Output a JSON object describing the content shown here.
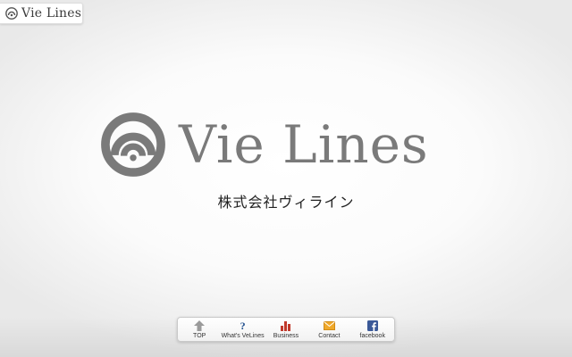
{
  "brand": {
    "mini_logo_text": "Vie Lines",
    "name": "Vie Lines",
    "company_name": "株式会社ヴィライン",
    "logo_color": "#7a7a7a"
  },
  "nav": {
    "items": [
      {
        "label": "TOP",
        "icon": "up-arrow-icon",
        "color": "#9a9a9a"
      },
      {
        "label": "What's VeLines",
        "icon": "question-icon",
        "color": "#1f4e8c"
      },
      {
        "label": "Business",
        "icon": "bar-chart-icon",
        "color": "#c0392b"
      },
      {
        "label": "Contact",
        "icon": "envelope-icon",
        "color": "#f0a92a"
      },
      {
        "label": "facebook",
        "icon": "facebook-icon",
        "color": "#3b5998"
      }
    ]
  }
}
